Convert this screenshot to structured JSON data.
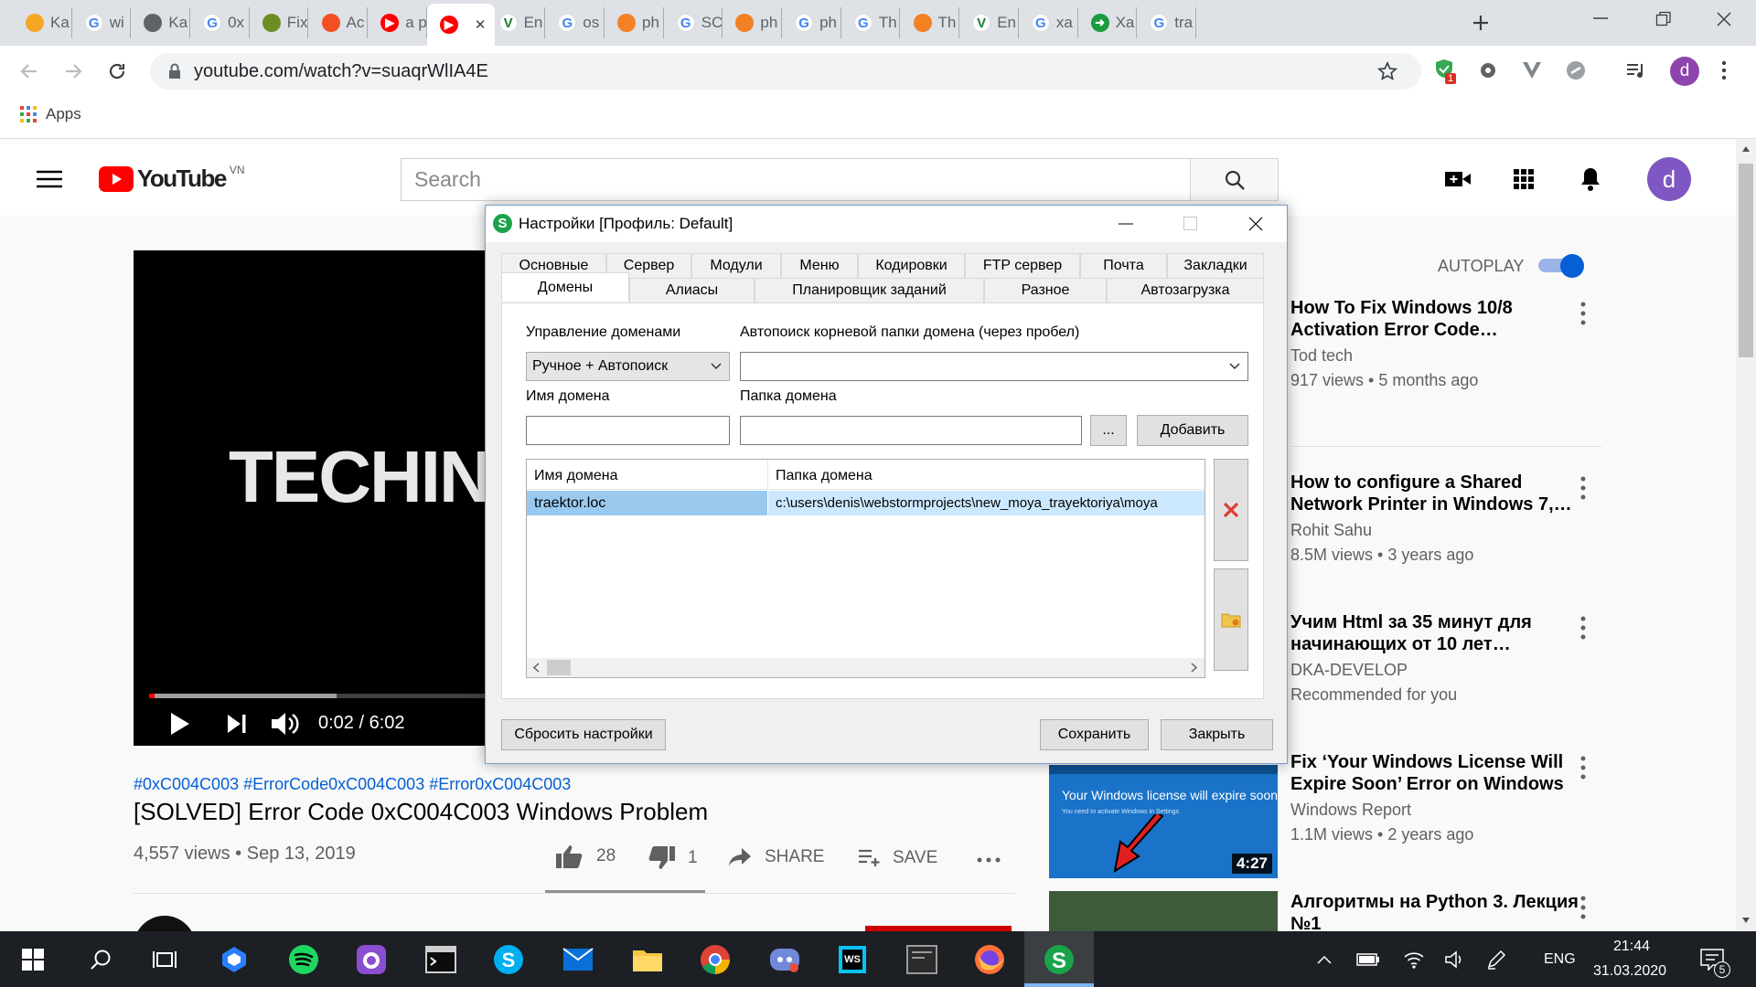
{
  "browser": {
    "tabs": [
      {
        "label": "Ka",
        "fav_color": "#f5a623",
        "fav_glyph": ""
      },
      {
        "label": "wi",
        "fav_color": "#4285f4",
        "fav_glyph": "G"
      },
      {
        "label": "Ka",
        "fav_color": "#5f6368",
        "fav_glyph": ""
      },
      {
        "label": "0x",
        "fav_color": "#4285f4",
        "fav_glyph": "G"
      },
      {
        "label": "Fix",
        "fav_color": "#6b8e23",
        "fav_glyph": ""
      },
      {
        "label": "Ac",
        "fav_color": "#f25022",
        "fav_glyph": ""
      },
      {
        "label": "a p",
        "fav_color": "#ff0000",
        "fav_glyph": "▶"
      },
      {
        "label": "",
        "fav_color": "#ff0000",
        "fav_glyph": "▶"
      },
      {
        "label": "En",
        "fav_color": "#1a7f37",
        "fav_glyph": "V"
      },
      {
        "label": "os",
        "fav_color": "#4285f4",
        "fav_glyph": "G"
      },
      {
        "label": "ph",
        "fav_color": "#f48024",
        "fav_glyph": ""
      },
      {
        "label": "SC",
        "fav_color": "#4285f4",
        "fav_glyph": "G"
      },
      {
        "label": "ph",
        "fav_color": "#f48024",
        "fav_glyph": ""
      },
      {
        "label": "ph",
        "fav_color": "#4285f4",
        "fav_glyph": "G"
      },
      {
        "label": "Th",
        "fav_color": "#4285f4",
        "fav_glyph": "G"
      },
      {
        "label": "Th",
        "fav_color": "#f48024",
        "fav_glyph": ""
      },
      {
        "label": "En",
        "fav_color": "#1a7f37",
        "fav_glyph": "V"
      },
      {
        "label": "xa",
        "fav_color": "#4285f4",
        "fav_glyph": "G"
      },
      {
        "label": "Xa",
        "fav_color": "#1a9c3e",
        "fav_glyph": "➜"
      },
      {
        "label": "tra",
        "fav_color": "#4285f4",
        "fav_glyph": "G"
      }
    ],
    "url": "youtube.com/watch?v=suaqrWlIA4E",
    "apps_label": "Apps",
    "profile_initial": "d",
    "extension_badge": "1"
  },
  "youtube": {
    "logo_text": "YouTube",
    "region": "VN",
    "search_placeholder": "Search",
    "avatar_initial": "d",
    "video": {
      "overlay_text": "TECHIN",
      "time": "0:02 / 6:02",
      "hashtags": "#0xC004C003 #ErrorCode0xC004C003 #Error0xC004C003",
      "title": "[SOLVED] Error Code 0xC004C003 Windows Problem",
      "meta": "4,557 views • Sep 13, 2019",
      "likes": "28",
      "dislikes": "1",
      "share_label": "SHARE",
      "save_label": "SAVE",
      "progress_fraction": 0.006
    },
    "autoplay_label": "AUTOPLAY",
    "related": [
      {
        "title": "How To Fix Windows 10/8 Activation Error Code…",
        "channel": "Tod tech",
        "meta": "917 views • 5 months ago"
      },
      {
        "title": "How to configure a Shared Network Printer in Windows 7,…",
        "channel": "Rohit Sahu",
        "meta": "8.5M views • 3 years ago"
      },
      {
        "title": "Учим Html за 35 минут для начинающих от 10 лет…",
        "channel": "DKA-DEVELOP",
        "meta": "Recommended for you"
      },
      {
        "title": "Fix ‘Your Windows License Will Expire Soon’ Error on Windows",
        "channel": "Windows Report",
        "meta": "1.1M views • 2 years ago",
        "thumb_text": "Your Windows license will expire soon",
        "thumb_sub": "You need to activate Windows in Settings",
        "duration": "4:27"
      },
      {
        "title": "Алгоритмы на Python 3. Лекция №1",
        "channel": "",
        "meta": ""
      }
    ]
  },
  "dialog": {
    "title": "Настройки [Профиль: Default]",
    "tabs_row1": [
      "Основные",
      "Сервер",
      "Модули",
      "Меню",
      "Кодировки",
      "FTP сервер",
      "Почта",
      "Закладки"
    ],
    "tabs_row2": [
      "Домены",
      "Алиасы",
      "Планировщик заданий",
      "Разное",
      "Автозагрузка"
    ],
    "active_tab": "Домены",
    "domain_mgmt_label": "Управление доменами",
    "domain_mgmt_value": "Ручное + Автопоиск",
    "autosearch_label": "Автопоиск корневой папки домена (через пробел)",
    "autosearch_value": "",
    "domain_name_label": "Имя домена",
    "domain_name_value": "",
    "domain_folder_label": "Папка домена",
    "domain_folder_value": "",
    "browse_label": "...",
    "add_label": "Добавить",
    "table": {
      "columns": [
        "Имя домена",
        "Папка домена"
      ],
      "rows": [
        [
          "traektor.loc",
          "c:\\users\\denis\\webstormprojects\\new_moya_trayektoriya\\moya"
        ]
      ]
    },
    "reset_label": "Сбросить настройки",
    "save_label": "Сохранить",
    "close_label": "Закрыть"
  },
  "taskbar": {
    "lang": "ENG",
    "time": "21:44",
    "date": "31.03.2020",
    "notification_count": "5"
  }
}
